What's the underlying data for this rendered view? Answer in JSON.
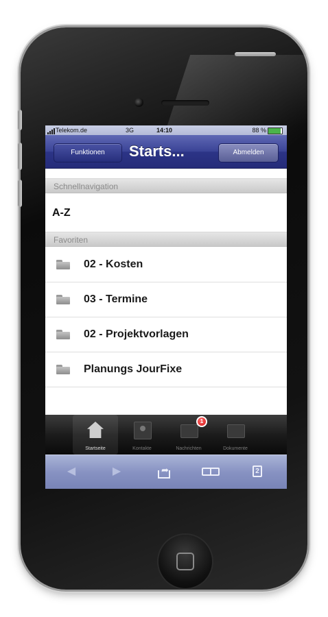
{
  "statusbar": {
    "carrier": "Telekom.de",
    "network": "3G",
    "time": "14:10",
    "battery_text": "88 %",
    "battery_level": 0.88
  },
  "navbar": {
    "left_button": "Funktionen",
    "title": "Starts...",
    "right_button": "Abmelden"
  },
  "sections": {
    "quick_nav_header": "Schnellnavigation",
    "az_item": "A-Z",
    "favorites_header": "Favoriten"
  },
  "favorites": [
    {
      "label": "02 - Kosten",
      "icon": "folder-icon"
    },
    {
      "label": "03 - Termine",
      "icon": "folder-icon"
    },
    {
      "label": "02 - Projektvorlagen",
      "icon": "folder-icon"
    },
    {
      "label": "Planungs JourFixe",
      "icon": "folder-icon"
    }
  ],
  "tabbar": {
    "tabs": [
      {
        "label": "Startseite",
        "icon": "house-icon",
        "active": true
      },
      {
        "label": "Kontakte",
        "icon": "person-icon",
        "active": false
      },
      {
        "label": "Nachrichten",
        "icon": "mail-icon",
        "active": false,
        "badge": "1"
      },
      {
        "label": "Dokumente",
        "icon": "folder-icon",
        "active": false
      }
    ]
  },
  "safari_toolbar": {
    "back_icon": "back-arrow-icon",
    "forward_icon": "forward-arrow-icon",
    "share_icon": "share-icon",
    "bookmarks_icon": "bookmarks-icon",
    "pages_icon": "pages-icon",
    "pages_count": "2"
  },
  "colors": {
    "navbar_blue": "#2c3487",
    "toolbar_blue": "#8792c2",
    "badge_red": "#d41616"
  }
}
